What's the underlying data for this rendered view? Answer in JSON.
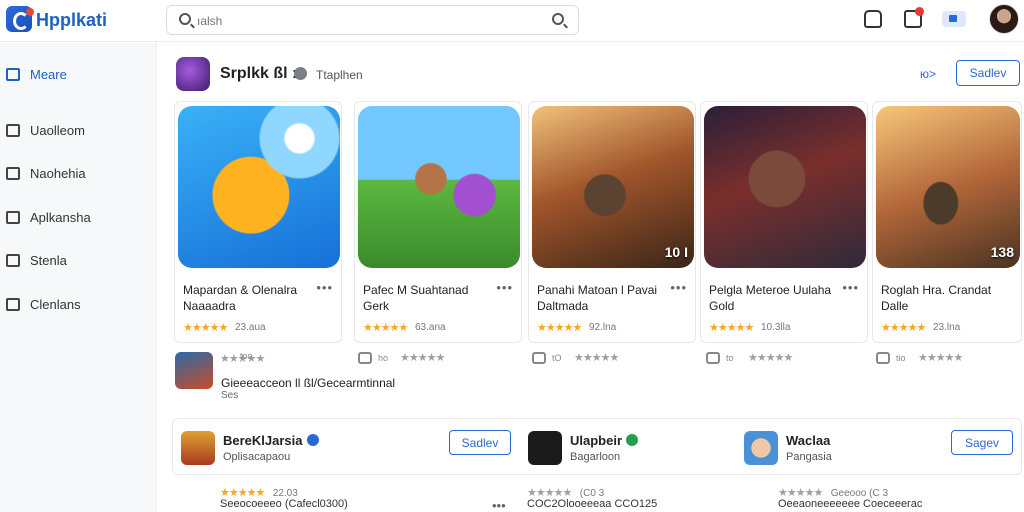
{
  "header": {
    "app_name": "Hpplkati",
    "search_value": "",
    "search_placeholder": "ıalsh"
  },
  "sidebar": {
    "items": [
      {
        "label": "Meare",
        "icon": "home-icon",
        "active": true
      },
      {
        "label": "Uaolleom",
        "icon": "grid-icon",
        "active": false
      },
      {
        "label": "Naohehia",
        "icon": "tag-icon",
        "active": false
      },
      {
        "label": "Aplkansha",
        "icon": "apps-icon",
        "active": false
      },
      {
        "label": "Stenla",
        "icon": "home-icon",
        "active": false
      },
      {
        "label": "Clenlans",
        "icon": "people-icon",
        "active": false
      }
    ]
  },
  "section": {
    "title": "Srplkk ßl :",
    "subtitle": "Ttaplhen",
    "nav_label": "ю>",
    "button_label": "Sadlev"
  },
  "cards": [
    {
      "title1": "Mapardan & Olenalra",
      "title2": "Naaaadra",
      "rating": "23.aua",
      "badge": ""
    },
    {
      "title1": "Pafec M Suahtanad",
      "title2": "Gerk",
      "rating": "63.ana",
      "badge": ""
    },
    {
      "title1": "Panahi Matoan l Pavai",
      "title2": "Daltmada",
      "rating": "92.lna",
      "badge": "10 I"
    },
    {
      "title1": "Pelgla Meteroe Uulaha",
      "title2": "Gold",
      "rating": "10.3lla",
      "badge": ""
    },
    {
      "title1": "Roglah Hra. Crandat",
      "title2": "Dalle",
      "rating": "23.lna",
      "badge": "138"
    }
  ],
  "mini_rows": [
    {
      "text": "tos"
    },
    {
      "text": "ho"
    },
    {
      "text": "tO"
    },
    {
      "text": "to"
    },
    {
      "text": "tio"
    }
  ],
  "promo": {
    "text": "Gieeeacceon ll ßl/Gecearmtinnal",
    "sub": "Ses"
  },
  "apps": [
    {
      "name": "BereKlJarsia",
      "desc": "Oplisacapaou",
      "button": "Sadlev",
      "verified_color": "#2c67d6"
    },
    {
      "name": "Ulapbeir",
      "desc": "Bagarloon",
      "button": "",
      "verified_color": "#22a04b"
    },
    {
      "name": "Waclaa",
      "desc": "Pangasia",
      "button": "Sagev",
      "verified_color": ""
    }
  ],
  "bottom": [
    {
      "stars": "★★★★★",
      "value": "22.03",
      "text": "Seeocoeeeo (Cafecl0300)"
    },
    {
      "stars": "★★★★★",
      "value": "(C0 3",
      "text": "COC2Olooeeeaa CCO125"
    },
    {
      "stars": "★★★★★",
      "value": "Geeooo (C 3",
      "text": "Oeeaoneeeeeee Coeceeerac"
    }
  ],
  "colors": {
    "accent": "#2c67d6",
    "brand": "#1f5fc8",
    "star": "#f5a623"
  }
}
